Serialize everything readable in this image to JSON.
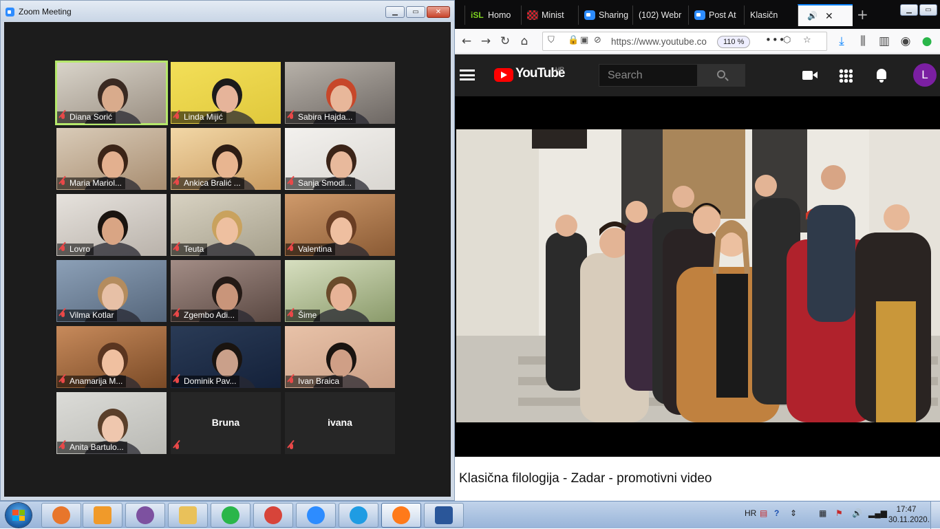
{
  "zoom": {
    "title": "Zoom Meeting",
    "participants": [
      {
        "name": "Diana Sorić",
        "active": true,
        "bg": [
          "#d9d4ca",
          "#9a8f82"
        ],
        "skin": "#d9ab8c",
        "hair": "#3a2a22"
      },
      {
        "name": "Linda Mijić",
        "active": false,
        "bg": [
          "#f3df58",
          "#e0c83c"
        ],
        "skin": "#e6b49a",
        "hair": "#1b1b1b"
      },
      {
        "name": "Sabira Hajda...",
        "active": false,
        "bg": [
          "#b7b1a9",
          "#6d6763"
        ],
        "skin": "#e8b79a",
        "hair": "#c7472a"
      },
      {
        "name": "Maria Mariol...",
        "active": false,
        "bg": [
          "#d9cbb8",
          "#a88d70"
        ],
        "skin": "#e3b08f",
        "hair": "#3b2417"
      },
      {
        "name": "Ankica Bralić ...",
        "active": false,
        "bg": [
          "#f2d7a6",
          "#c99a5f"
        ],
        "skin": "#e8b590",
        "hair": "#2e1d14"
      },
      {
        "name": "Sanja Smodl...",
        "active": false,
        "bg": [
          "#f3f1ee",
          "#d9d6d1"
        ],
        "skin": "#e8b99c",
        "hair": "#3b2418"
      },
      {
        "name": "Lovro",
        "active": false,
        "bg": [
          "#e6e2dd",
          "#b9b2aa"
        ],
        "skin": "#d9a584",
        "hair": "#1a1410"
      },
      {
        "name": "Teuta",
        "active": false,
        "bg": [
          "#d8d2c2",
          "#a6a08c"
        ],
        "skin": "#eec0a0",
        "hair": "#c9a25e"
      },
      {
        "name": "Valentina",
        "active": false,
        "bg": [
          "#cf9a6b",
          "#8a5a34"
        ],
        "skin": "#efbfa0",
        "hair": "#6a3e24"
      },
      {
        "name": "Vilma Kotlar",
        "active": false,
        "bg": [
          "#8ca0b7",
          "#55667b"
        ],
        "skin": "#e7c0a6",
        "hair": "#b48c5e"
      },
      {
        "name": "Zgembo Adi...",
        "active": false,
        "bg": [
          "#a38d86",
          "#5a4842"
        ],
        "skin": "#c9957a",
        "hair": "#241a16"
      },
      {
        "name": "Šime",
        "active": false,
        "bg": [
          "#d7dfc0",
          "#8a9a6a"
        ],
        "skin": "#e7b397",
        "hair": "#6a4a2a"
      },
      {
        "name": "Anamarija M...",
        "active": false,
        "bg": [
          "#c78a5b",
          "#7a4a26"
        ],
        "skin": "#f0c0a0",
        "hair": "#5a3520"
      },
      {
        "name": "Dominik Pav...",
        "active": false,
        "bg": [
          "#2a3b56",
          "#14213a"
        ],
        "skin": "#caa08a",
        "hair": "#1a1410"
      },
      {
        "name": "Ivan Braica",
        "active": false,
        "bg": [
          "#e8c2a8",
          "#c99e85"
        ],
        "skin": "#cf9f86",
        "hair": "#1a1410"
      },
      {
        "name": "Anita Bartulo...",
        "active": false,
        "bg": [
          "#dcdcd8",
          "#b9b9b4"
        ],
        "skin": "#efc7ae",
        "hair": "#5a3f2a"
      },
      {
        "name": "Bruna",
        "active": false,
        "blank": true
      },
      {
        "name": "ivana",
        "active": false,
        "blank": true
      }
    ]
  },
  "browser": {
    "tabs": [
      {
        "label": "Homo",
        "icon": "isl-icon",
        "prefix": "iSL"
      },
      {
        "label": "Minist",
        "icon": "checkered-icon"
      },
      {
        "label": "Sharing",
        "icon": "zoom-icon"
      },
      {
        "label": "(102) Webr",
        "icon": "none"
      },
      {
        "label": "Post At",
        "icon": "zoom-icon"
      },
      {
        "label": "Klasičn",
        "icon": "youtube-icon"
      },
      {
        "label": "",
        "icon": "youtube-icon",
        "selected": true
      }
    ],
    "url": "https://www.youtube.co",
    "zoom_level": "110 %"
  },
  "youtube": {
    "brand": "YouTube",
    "country": "HR",
    "search_placeholder": "Search",
    "avatar_letter": "L",
    "video_title": "Klasična filologija - Zadar - promotivni video"
  },
  "taskbar": {
    "language": "HR",
    "time": "17:47",
    "date": "30.11.2020.",
    "apps": [
      {
        "name": "sun-app-icon",
        "color": "#e8762b"
      },
      {
        "name": "media-player-icon",
        "color": "#f09a2a"
      },
      {
        "name": "viber-icon",
        "color": "#7d51a0"
      },
      {
        "name": "file-explorer-icon",
        "color": "#e9c15a"
      },
      {
        "name": "whatsapp-icon",
        "color": "#2ab64a"
      },
      {
        "name": "chrome-icon",
        "color": "#d7443a"
      },
      {
        "name": "zoom-icon",
        "color": "#2d8cff"
      },
      {
        "name": "skype-icon",
        "color": "#1f9ce3"
      },
      {
        "name": "firefox-icon",
        "color": "#ff7a1a"
      },
      {
        "name": "word-icon",
        "color": "#2a5699"
      }
    ]
  },
  "colors": {
    "zoom_active": "#b5e86b",
    "youtube_red": "#ff0000",
    "firefox_accent": "#0a84ff"
  }
}
